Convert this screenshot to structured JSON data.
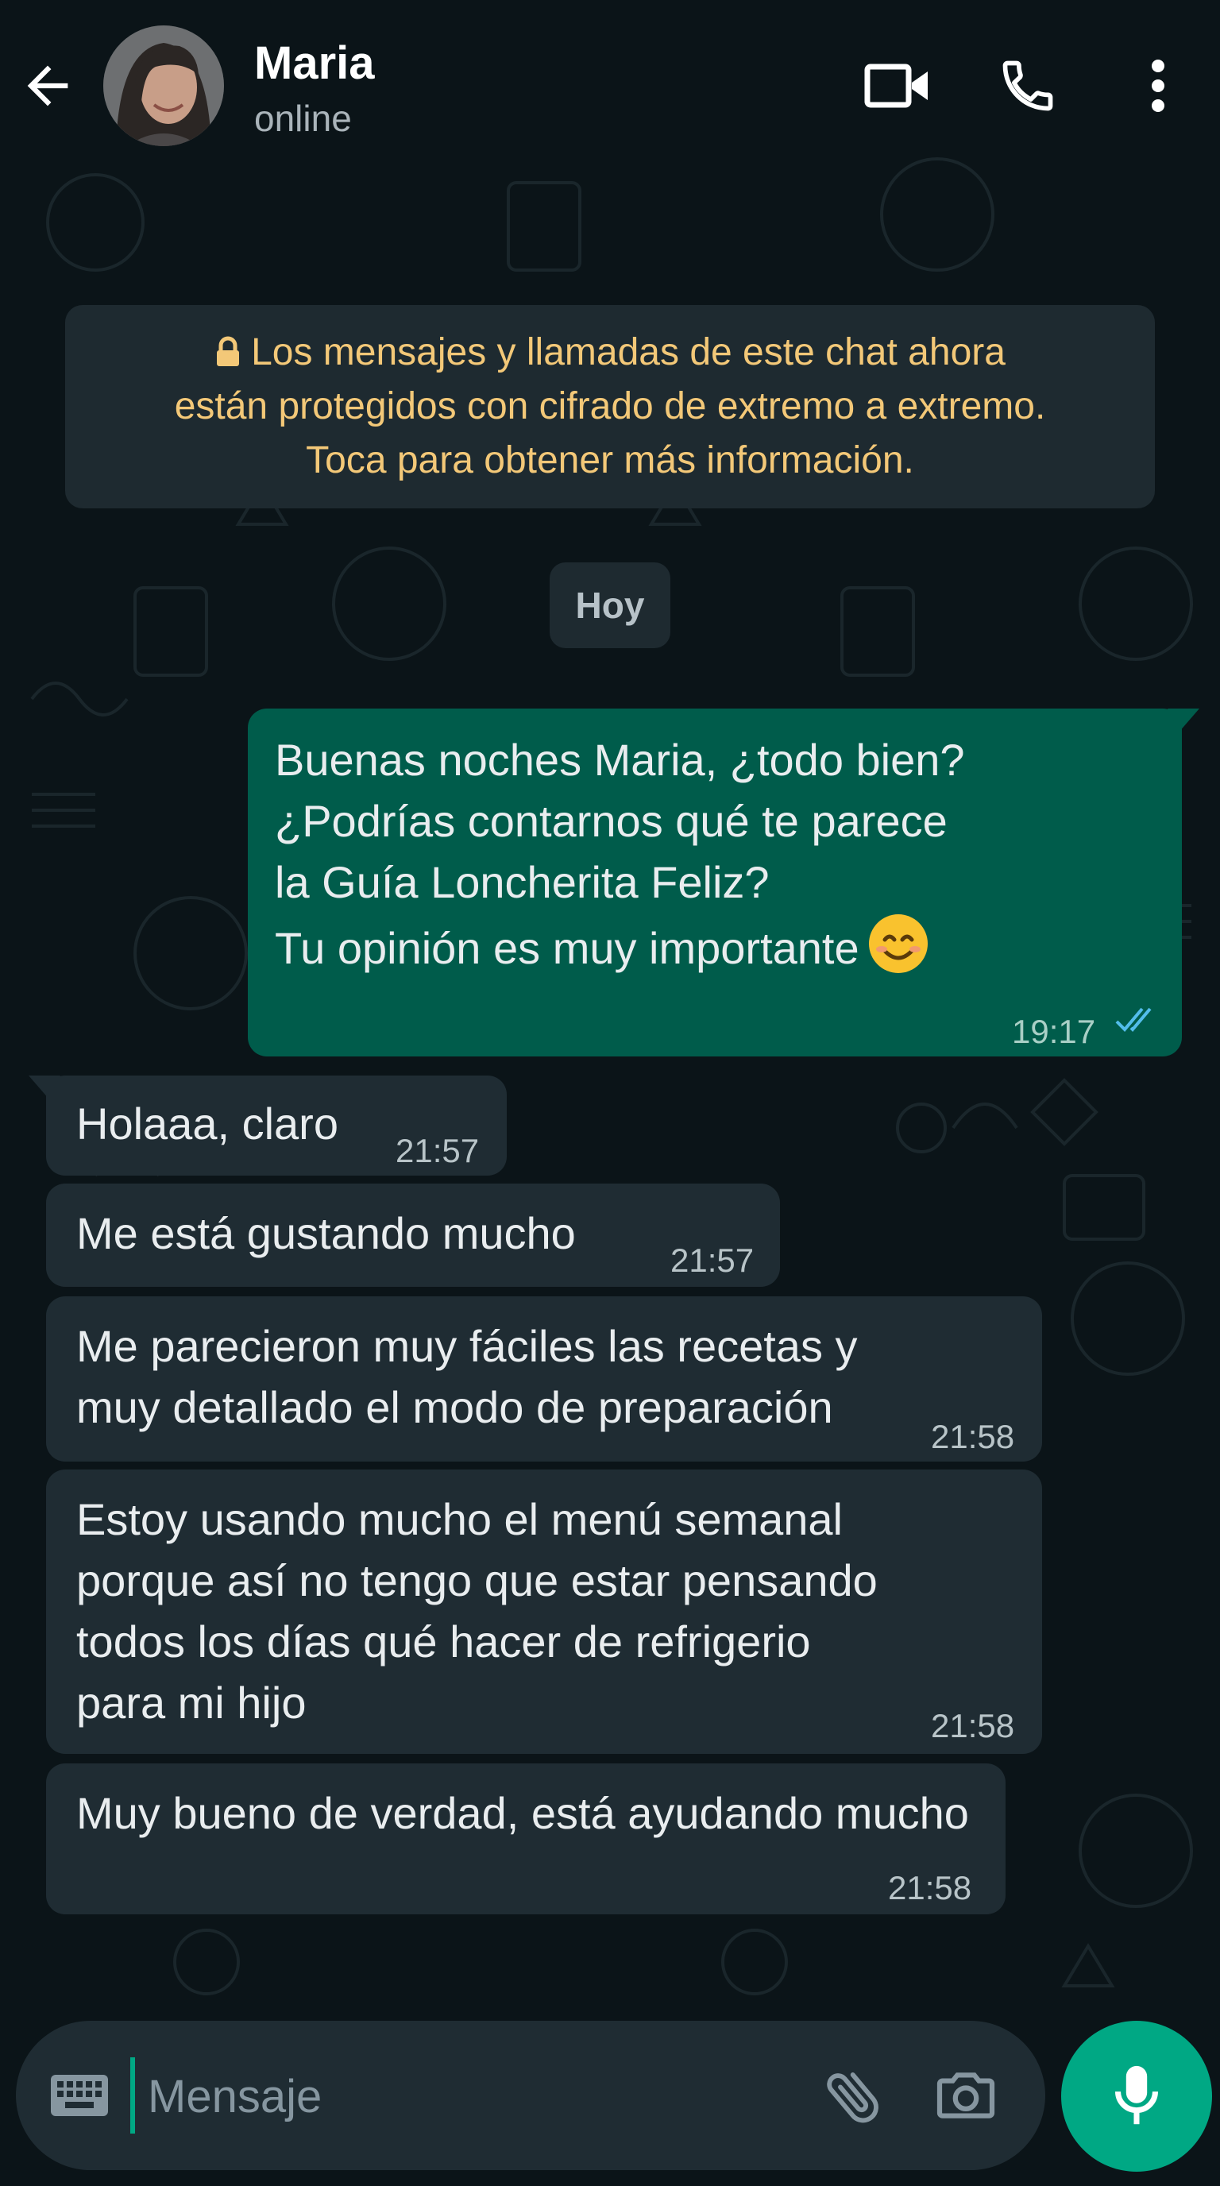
{
  "header": {
    "contact_name": "Maria",
    "status": "online"
  },
  "e2e_notice": {
    "lines": [
      "Los mensajes y llamadas de este chat ahora",
      "están protegidos con cifrado de extremo a extremo.",
      "Toca para obtener más información."
    ]
  },
  "date_chip": "Hoy",
  "messages": [
    {
      "direction": "outgoing",
      "lines": [
        "Buenas noches Maria, ¿todo bien?",
        "¿Podrías contarnos qué te parece",
        "la Guía Loncherita Feliz?",
        "Tu opinión es muy importante"
      ],
      "emoji": "smiling-face-emoji",
      "time": "19:17",
      "status_icon": "double-check-icon",
      "status_color": "#53bdeb"
    },
    {
      "direction": "incoming",
      "lines": [
        "Holaaa, claro"
      ],
      "time": "21:57"
    },
    {
      "direction": "incoming",
      "lines": [
        "Me está gustando mucho"
      ],
      "time": "21:57"
    },
    {
      "direction": "incoming",
      "lines": [
        "Me parecieron muy fáciles las recetas y",
        "muy detallado el modo de preparación"
      ],
      "time": "21:58"
    },
    {
      "direction": "incoming",
      "lines": [
        "Estoy usando mucho el menú semanal",
        "porque así no tengo que estar pensando",
        "todos los días qué hacer de refrigerio",
        "para mi hijo"
      ],
      "time": "21:58"
    },
    {
      "direction": "incoming",
      "lines": [
        "Muy bueno de verdad, está ayudando mucho"
      ],
      "time": "21:58"
    }
  ],
  "composer": {
    "placeholder": "Mensaje"
  },
  "colors": {
    "background": "#0b1418",
    "incoming_bubble": "#1f2c33",
    "outgoing_bubble": "#005c4b",
    "notice_text": "#f3c878",
    "accent": "#00a884"
  },
  "icons": [
    "back-arrow-icon",
    "video-call-icon",
    "phone-icon",
    "more-vert-icon",
    "lock-icon",
    "keyboard-icon",
    "attach-icon",
    "camera-icon",
    "mic-icon"
  ]
}
